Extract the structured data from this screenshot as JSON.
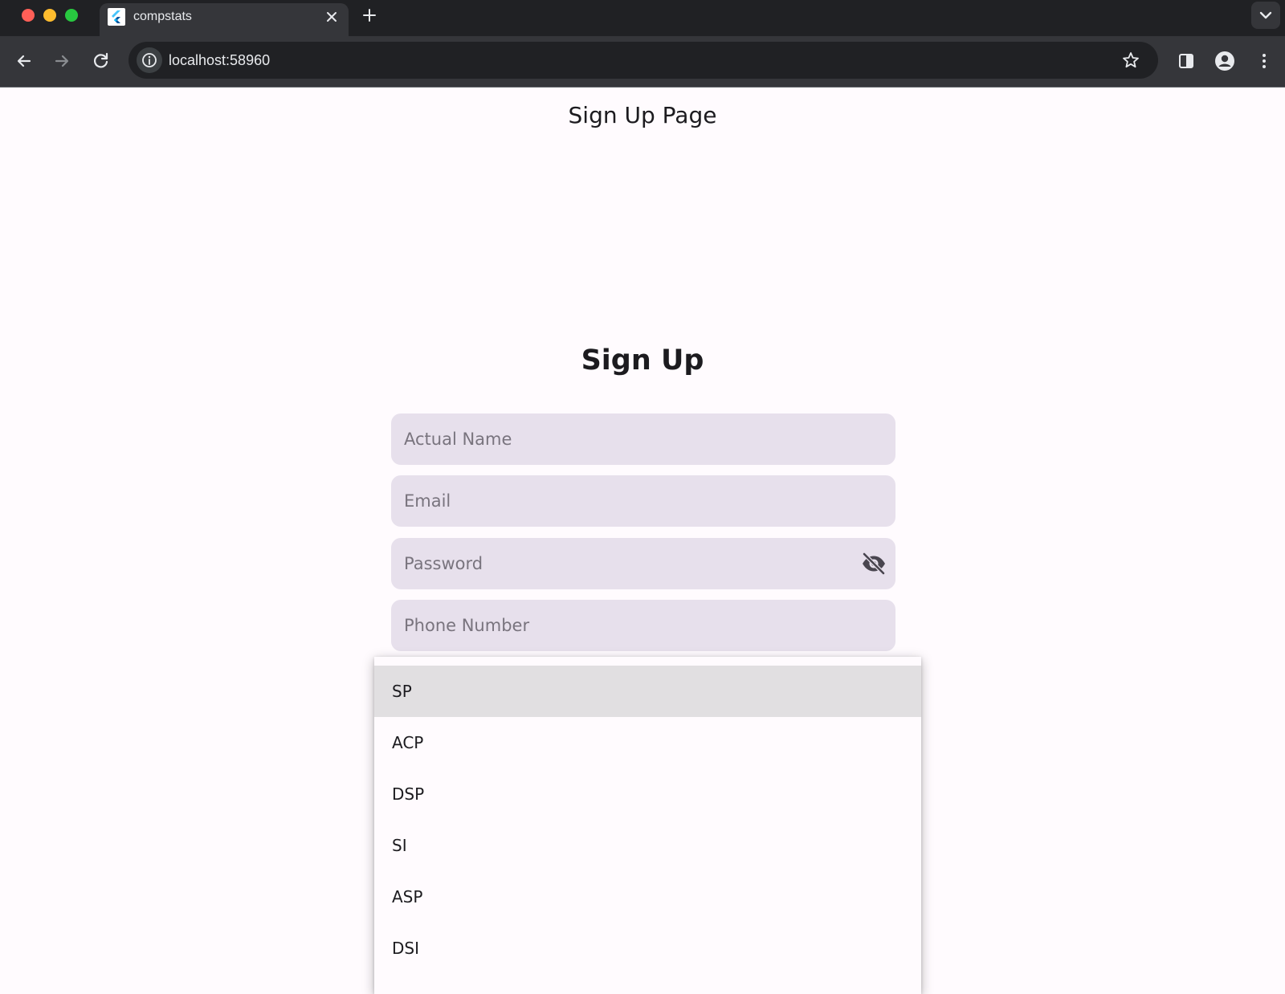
{
  "browser": {
    "tab_title": "compstats",
    "url": "localhost:58960"
  },
  "page": {
    "title": "Sign Up Page",
    "heading": "Sign Up"
  },
  "form": {
    "name_placeholder": "Actual Name",
    "email_placeholder": "Email",
    "password_placeholder": "Password",
    "phone_placeholder": "Phone Number"
  },
  "dropdown": {
    "options": [
      "SP",
      "ACP",
      "DSP",
      "SI",
      "ASP",
      "DSI"
    ],
    "highlighted": "SP"
  },
  "colors": {
    "field_background": "#e7e0ec",
    "page_background": "#fffbfe",
    "highlight": "#e1dfe1"
  },
  "icons": [
    "back-icon",
    "forward-icon",
    "reload-icon",
    "info-icon",
    "star-icon",
    "side-panel-icon",
    "profile-icon",
    "more-icon",
    "visibility-off-icon"
  ]
}
